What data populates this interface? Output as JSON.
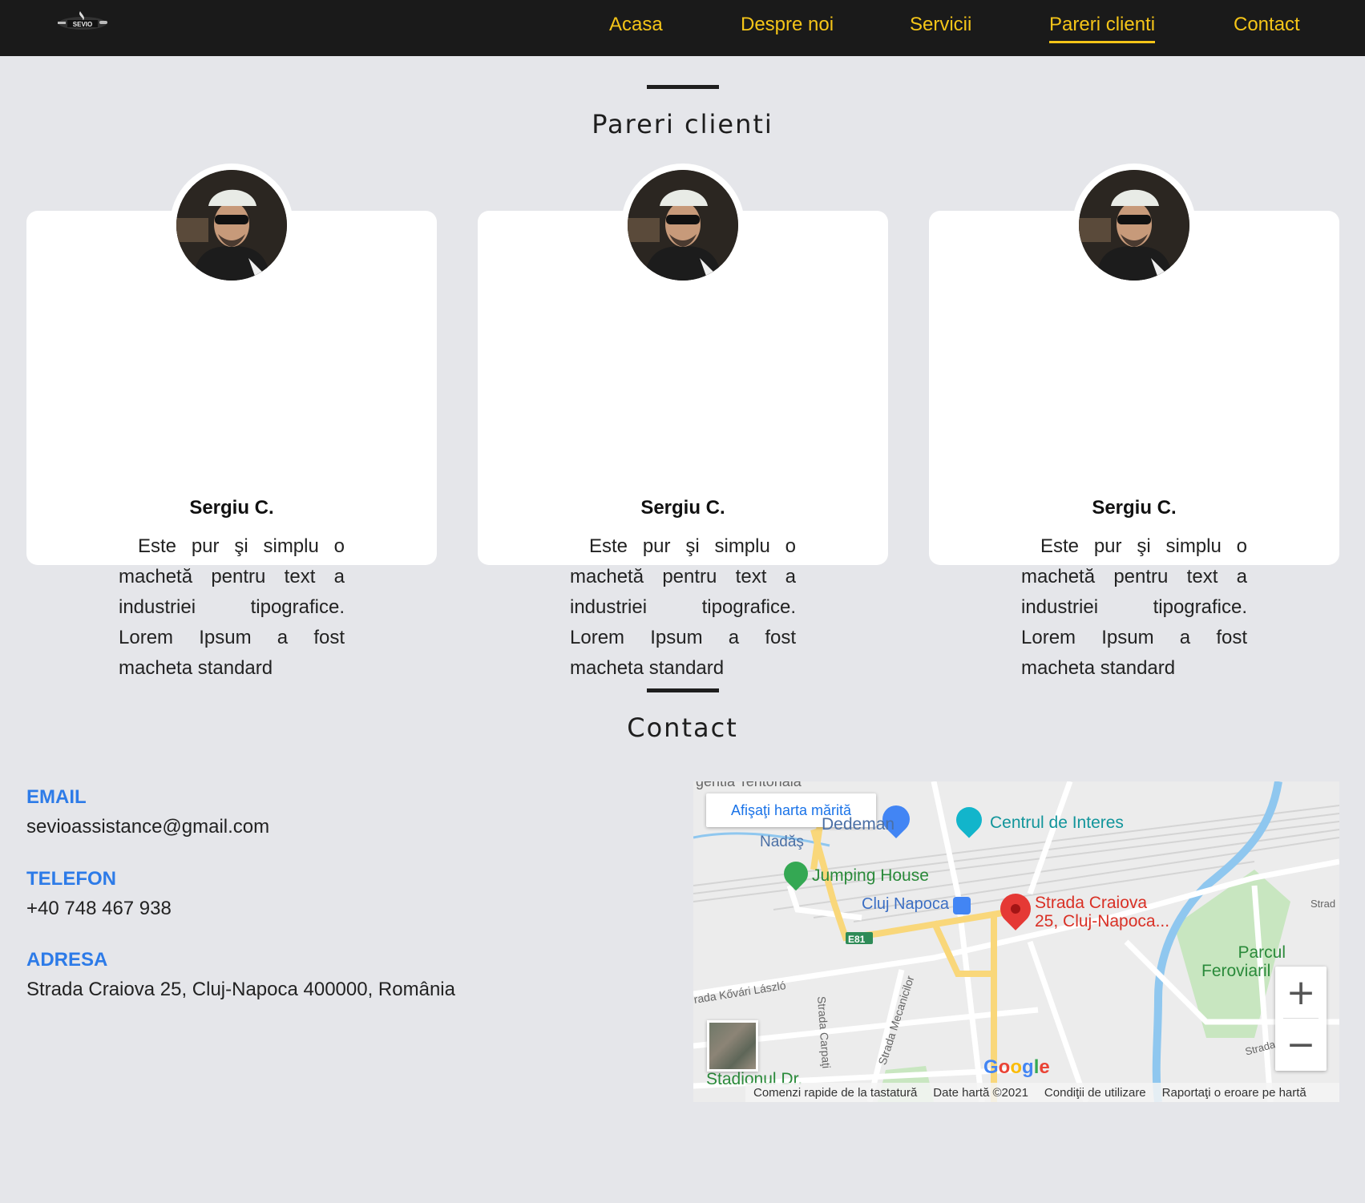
{
  "nav": {
    "logo_text": "SEVIO",
    "links": [
      {
        "label": "Acasa"
      },
      {
        "label": "Despre noi"
      },
      {
        "label": "Servicii"
      },
      {
        "label": "Pareri clienti",
        "active": true
      },
      {
        "label": "Contact"
      }
    ]
  },
  "testimonials": {
    "title": "Pareri clienti",
    "cards": [
      {
        "text": "Este pur şi simplu o machetă pentru text a industriei tipografice. Lorem Ipsum a fost macheta standard",
        "author": "Sergiu C."
      },
      {
        "text": "Este pur şi simplu o machetă pentru text a industriei tipografice. Lorem Ipsum a fost macheta standard",
        "author": "Sergiu C."
      },
      {
        "text": "Este pur şi simplu o machetă pentru text a industriei tipografice. Lorem Ipsum a fost macheta standard",
        "author": "Sergiu C."
      }
    ]
  },
  "contact": {
    "title": "Contact",
    "email_label": "EMAIL",
    "email": "sevioassistance@gmail.com",
    "phone_label": "TELEFON",
    "phone": "+40 748 467 938",
    "address_label": "ADRESA",
    "address": "Strada Craiova 25, Cluj-Napoca 400000, România"
  },
  "map": {
    "view_larger": "Afişaţi harta mărită",
    "places": {
      "dedeman": "Dedeman",
      "centrul": "Centrul de Interes",
      "nadas": "Nadăş",
      "jumping": "Jumping House",
      "cluj_station": "Cluj Napoca",
      "pin_line1": "Strada Craiova",
      "pin_line2": "25, Cluj-Napoca...",
      "parcul_line1": "Parcul",
      "parcul_line2": "Feroviaril",
      "e81": "E81",
      "kovari": "rada Kővári László",
      "carpati": "Strada Carpaţi",
      "mecanicilor": "Strada Mecanicilor",
      "stadionul": "Stadionul Dr.",
      "strad1": "Strad",
      "strada2": "Strada"
    },
    "footer": {
      "shortcuts": "Comenzi rapide de la tastatură",
      "mapdata": "Date hartă ©2021",
      "terms": "Condiţii de utilizare",
      "report": "Raportaţi o eroare pe hartă"
    },
    "google": "Google",
    "zoom_in": "+",
    "zoom_out": "−"
  },
  "colors": {
    "nav_bg": "#1a1a1a",
    "nav_link": "#f5c518",
    "page_bg": "#e5e6ea",
    "contact_label": "#2d7be8",
    "pin": "#e53935"
  }
}
